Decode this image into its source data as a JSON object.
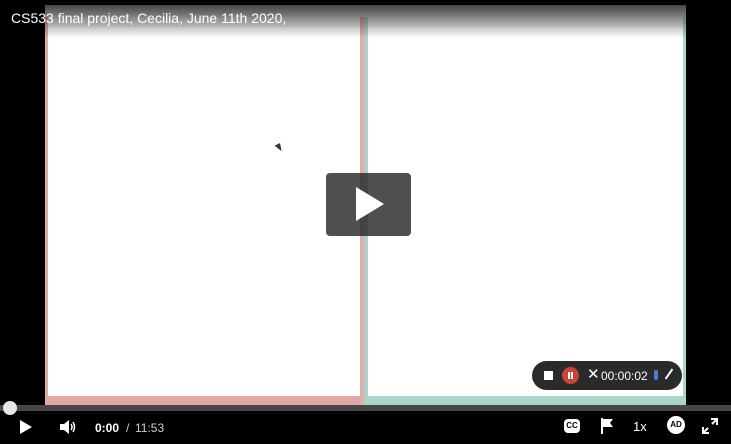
{
  "video": {
    "title": "CS533 final project, Cecilia, June 11th 2020,",
    "progress_fraction": 0.0
  },
  "recording": {
    "timer": "00:00:02"
  },
  "controls": {
    "current_time": "0:00",
    "separator": "/",
    "duration": "11:53",
    "captions_label": "CC",
    "speed_label": "1x",
    "audio_description_label": "AD"
  },
  "colors": {
    "left_pane_border": "#e2a8a6",
    "right_pane_border": "#a9d6cc",
    "record_pause": "#c8443a",
    "mic_accent": "#4a7fd1"
  }
}
